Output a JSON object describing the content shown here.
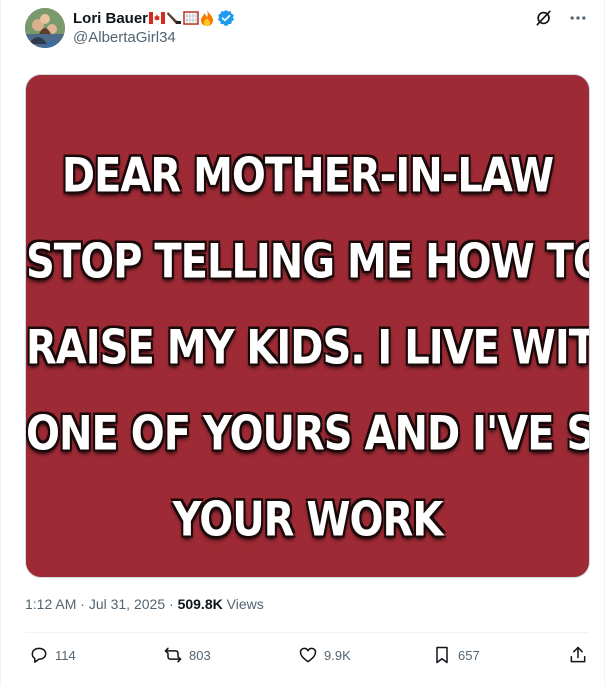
{
  "user": {
    "display_name": "Lori Bauer",
    "handle": "@AlbertaGirl34",
    "emoji": [
      "canadian-flag",
      "hockey-stick",
      "hockey-net",
      "fire"
    ]
  },
  "meme": {
    "lines": [
      "DEAR MOTHER-IN-LAW",
      "STOP TELLING ME HOW TO",
      "RAISE MY KIDS. I LIVE WITH",
      "ONE OF YOURS AND I'VE SEEN",
      "YOUR WORK"
    ],
    "background": "#9e2a35"
  },
  "meta": {
    "time": "1:12 AM",
    "date": "Jul 31, 2025",
    "views_count": "509.8K",
    "views_label": "Views"
  },
  "actions": {
    "replies": "114",
    "reposts": "803",
    "likes": "9.9K",
    "bookmarks": "657"
  },
  "colors": {
    "verified": "#1d9bf0",
    "muted": "#536471"
  }
}
